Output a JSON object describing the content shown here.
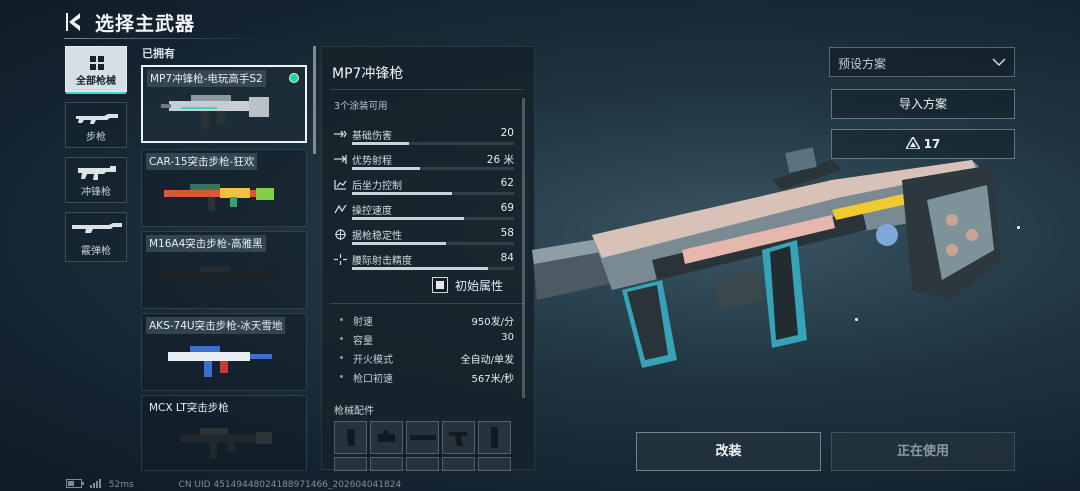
{
  "header": {
    "title": "选择主武器"
  },
  "categories": [
    {
      "label": "全部枪械",
      "icon": "grid-icon",
      "active": true
    },
    {
      "label": "步枪",
      "icon": "rifle-icon",
      "active": false
    },
    {
      "label": "冲锋枪",
      "icon": "smg-icon",
      "active": false
    },
    {
      "label": "霰弹枪",
      "icon": "shotgun-icon",
      "active": false
    }
  ],
  "owned": {
    "label": "已拥有",
    "weapons": [
      {
        "name": "MP7冲锋枪-电玩高手S2",
        "selected": true,
        "equipped": true
      },
      {
        "name": "CAR-15突击步枪-狂欢",
        "selected": false
      },
      {
        "name": "M16A4突击步枪-高雅黑",
        "selected": false
      },
      {
        "name": "AKS-74U突击步枪-冰天雪地",
        "selected": false
      },
      {
        "name": "MCX LT突击步枪",
        "selected": false
      }
    ]
  },
  "weapon_panel": {
    "name": "MP7冲锋枪",
    "skins_available": "3个涂装可用",
    "stats": [
      {
        "label": "基础伤害",
        "value": "20",
        "level": 0.35,
        "icon": "damage-icon"
      },
      {
        "label": "优势射程",
        "value": "26 米",
        "level": 0.42,
        "icon": "range-icon"
      },
      {
        "label": "后坐力控制",
        "value": "62",
        "level": 0.62,
        "icon": "recoil-icon"
      },
      {
        "label": "操控速度",
        "value": "69",
        "level": 0.69,
        "icon": "handling-icon"
      },
      {
        "label": "据枪稳定性",
        "value": "58",
        "level": 0.58,
        "icon": "stability-icon"
      },
      {
        "label": "腰际射击精度",
        "value": "84",
        "level": 0.84,
        "icon": "hipfire-icon"
      }
    ],
    "initial_attributes_label": "初始属性",
    "properties": [
      {
        "label": "射速",
        "value": "950发/分"
      },
      {
        "label": "容量",
        "value": "30"
      },
      {
        "label": "开火模式",
        "value": "全自动/单发"
      },
      {
        "label": "枪口初速",
        "value": "567米/秒"
      }
    ],
    "attachments_label": "枪械配件"
  },
  "right": {
    "preset_placeholder": "预设方案",
    "import_label": "导入方案",
    "likes": "17"
  },
  "actions": {
    "modify_label": "改装",
    "in_use_label": "正在使用"
  },
  "footer": {
    "ping": "52ms",
    "uid": "CN UID 4514944802418897146​6_202604041824"
  },
  "colors": {
    "accent": "#3fd6c6",
    "equipped": "#27d49a"
  }
}
